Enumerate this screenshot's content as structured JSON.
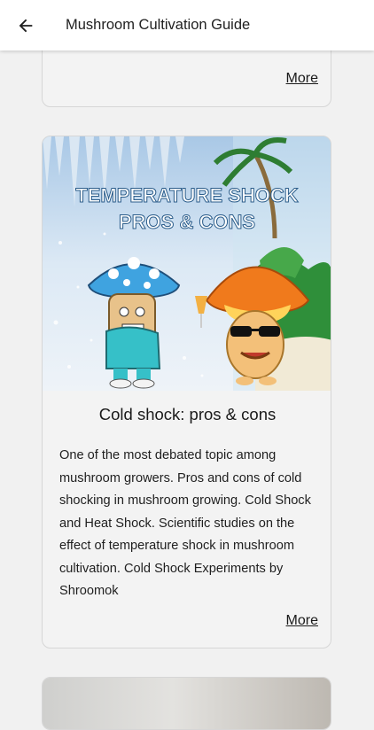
{
  "header": {
    "title": "Mushroom Cultivation Guide",
    "back_icon": "arrow-left-icon"
  },
  "cards": [
    {
      "more_label": "More"
    },
    {
      "image_text": [
        "TEMPERATURE SHOCK",
        "PROS & CONS"
      ],
      "title": "Cold shock: pros & cons",
      "description": "One of the most debated topic among mushroom growers. Pros and cons of cold shocking in mushroom growing. Cold Shock and Heat Shock. Scientific studies on the effect of temperature shock in mushroom cultivation. Cold Shock Experiments by Shroomok",
      "more_label": "More"
    },
    {}
  ],
  "colors": {
    "background": "#f1f1f1",
    "card": "#f3f3f3",
    "blue_cap": "#3fa3e0",
    "orange_cap": "#f07a1c"
  }
}
